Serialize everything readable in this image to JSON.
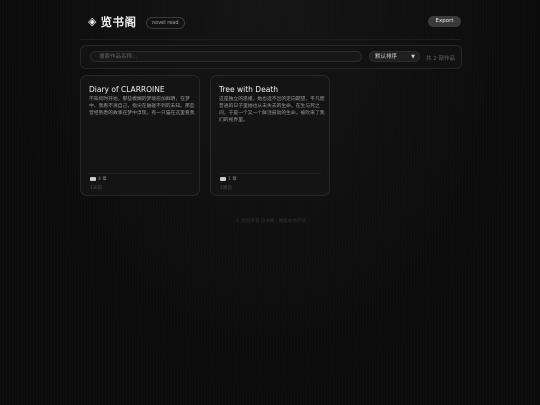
{
  "header": {
    "logo_icon": "◈",
    "app_title": "览书阁",
    "subtitle": "novel read",
    "export_label": "Export"
  },
  "search": {
    "placeholder": "搜索作品名称...",
    "sort_selected": "默认排序",
    "count_text": "共 2 部作品"
  },
  "cards": [
    {
      "title": "Diary of CLARROINE",
      "description": "不知何时开始，那些模糊的梦境愈加鲜明，在梦中，我看不清自己，指尖在触碰不到的未知。那些曾经熟悉的故事在梦中浮现，有一只猫在这里看我",
      "stat": "4 章",
      "date": "1天前"
    },
    {
      "title": "Tree with Death",
      "description": "这是独立的思绪，她也选不出的定向期望。平凡而普通的日子里她也从未失去的生命。在生与死之间，于是一个又一个鲜活鼓动的生命，被吹来了我们的视界里。",
      "stat": "1 章",
      "date": "1周前"
    }
  ],
  "footer": {
    "text": "© 版权所有 览书阁 · 数据本地存储"
  }
}
